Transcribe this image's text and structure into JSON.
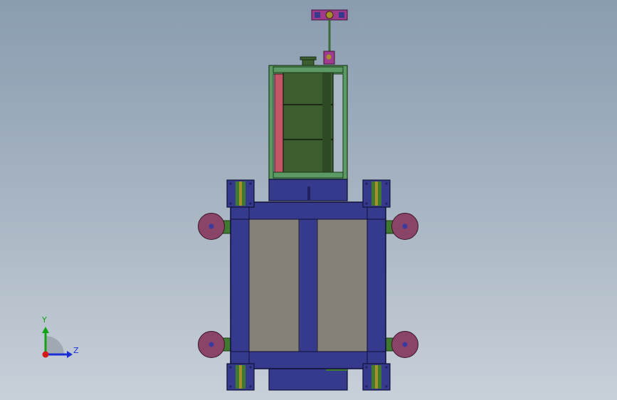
{
  "triad": {
    "y_label": "Y",
    "z_label": "Z",
    "y_color": "#13a313",
    "z_color": "#1a2ed6",
    "origin_color": "#d41818"
  },
  "colors": {
    "frame": "#363a8c",
    "frame_dark": "#1f2260",
    "panel": "#858179",
    "wheel": "#8a4468",
    "wheel_hub": "#3a3aa0",
    "bracket_green": "#3f7a2f",
    "motor_green": "#3c5d2e",
    "cage_green": "#5b9a64",
    "strip_red": "#c45566",
    "knob_magenta": "#a03a8c",
    "brass": "#a7902a"
  }
}
